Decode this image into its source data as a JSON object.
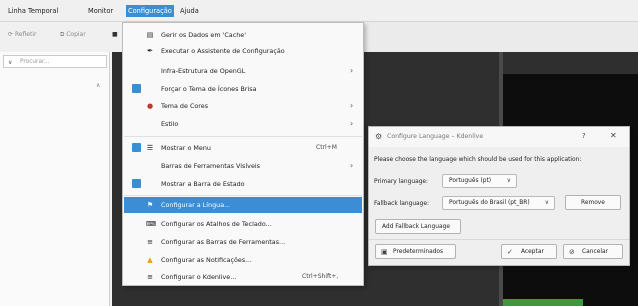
{
  "menubar": {
    "items": [
      {
        "label": "Linha Temporal",
        "active": false
      },
      {
        "label": "Monitor",
        "active": false
      },
      {
        "label": "Configuração",
        "active": true
      },
      {
        "label": "Ajuda",
        "active": false
      }
    ]
  },
  "toolbar": {
    "refresh_label": "Refletir",
    "cut_label": "Copiar"
  },
  "left_panel": {
    "search_placeholder": "Procurar..."
  },
  "config_menu": {
    "items": [
      {
        "label": "Gerir os Dados em 'Cache'",
        "icon": "database-icon"
      },
      {
        "label": "Executar o Assistente de Configuração",
        "icon": "wand-icon"
      },
      {
        "label": "Infra-Estrutura de OpenGL",
        "submenu": true
      },
      {
        "label": "Forçar o Tema de Ícones Brisa",
        "checked": true
      },
      {
        "label": "Tema de Cores",
        "icon": "palette-icon",
        "submenu": true
      },
      {
        "label": "Estilo",
        "submenu": true
      },
      {
        "label": "Mostrar o Menu",
        "checked": true,
        "icon": "menu-icon",
        "shortcut": "Ctrl+M"
      },
      {
        "label": "Barras de Ferramentas Visíveis",
        "submenu": true
      },
      {
        "label": "Mostrar a Barra de Estado",
        "checked": true
      },
      {
        "label": "Configurar a Língua...",
        "icon": "flag-icon",
        "highlighted": true
      },
      {
        "label": "Configurar os Atalhos de Teclado...",
        "icon": "keyboard-icon"
      },
      {
        "label": "Configurar as Barras de Ferramentas...",
        "icon": "toolbars-icon"
      },
      {
        "label": "Configurar as Notificações...",
        "icon": "bell-icon"
      },
      {
        "label": "Configurar o Kdenlive...",
        "icon": "settings-icon",
        "shortcut": "Ctrl+Shift+,"
      }
    ]
  },
  "dialog": {
    "title": "Configure Language – Kdenlive",
    "help_glyph": "?",
    "prompt": "Please choose the language which should be used for this application:",
    "primary_label": "Primary language:",
    "primary_value": "Português (pt)",
    "fallback_label": "Fallback language:",
    "fallback_value": "Português do Brasil (pt_BR)",
    "remove_label": "Remove",
    "add_fallback_label": "Add Fallback Language",
    "defaults_label": "Predeterminados",
    "accept_label": "Aceptar",
    "cancel_label": "Cancelar"
  },
  "colors": {
    "accent": "#3a8fd4",
    "timeline_dark": "#2f2f2f",
    "clip_green": "#3c9a3c"
  }
}
